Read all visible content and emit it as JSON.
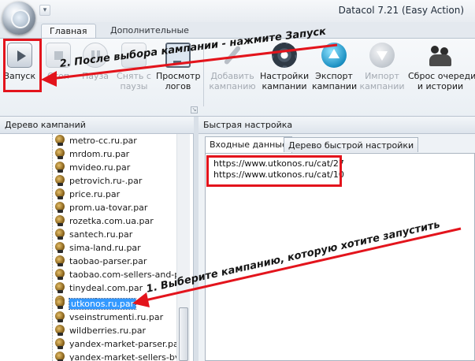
{
  "window": {
    "title": "Datacol 7.21 (Easy Action)"
  },
  "quick_access": [
    "▾"
  ],
  "ribbon_tabs": [
    {
      "label": "Главная",
      "active": true
    },
    {
      "label": "Дополнительные",
      "active": false
    }
  ],
  "ribbon": {
    "launch": "Запуск",
    "stop": "Стоп",
    "pause": "Пауза",
    "unpause_1": "Снять с",
    "unpause_2": "паузы",
    "view_logs_1": "Просмотр",
    "view_logs_2": "логов",
    "add_campaign_1": "Добавить",
    "add_campaign_2": "кампанию",
    "campaign_settings_1": "Настройки",
    "campaign_settings_2": "кампании",
    "export_1": "Экспорт",
    "export_2": "кампании",
    "import_1": "Импорт",
    "import_2": "кампании",
    "reset_1": "Сброс очереди",
    "reset_2": "и истории"
  },
  "left_pane": {
    "header": "Дерево кампаний",
    "items": [
      "metro-cc.ru.par",
      "mrdom.ru.par",
      "mvideo.ru.par",
      "petrovich.ru-.par",
      "price.ru.par",
      "prom.ua-tovar.par",
      "rozetka.com.ua.par",
      "santech.ru.par",
      "sima-land.ru.par",
      "taobao-parser.par",
      "taobao.com-sellers-and-pri",
      "tinydeal.com.par",
      "ulmart.ru.par",
      "utkonos.ru.par",
      "vseinstrumenti.ru.par",
      "wildberries.ru.par",
      "yandex-market-parser.par",
      "yandex-market-sellers-by-p"
    ],
    "selected_item": "utkonos.ru.par"
  },
  "right_pane": {
    "header": "Быстрая настройка",
    "tabs": [
      "Входные данные",
      "Дерево быстрой настройки"
    ],
    "input_lines": [
      "https://www.utkonos.ru/cat/27",
      "https://www.utkonos.ru/cat/10"
    ]
  },
  "annotations": {
    "step2": "2. После выбора кампании - нажмите Запуск",
    "step1": "1. Выберите кампанию, которую хотите запустить",
    "color": "#e3141c"
  }
}
